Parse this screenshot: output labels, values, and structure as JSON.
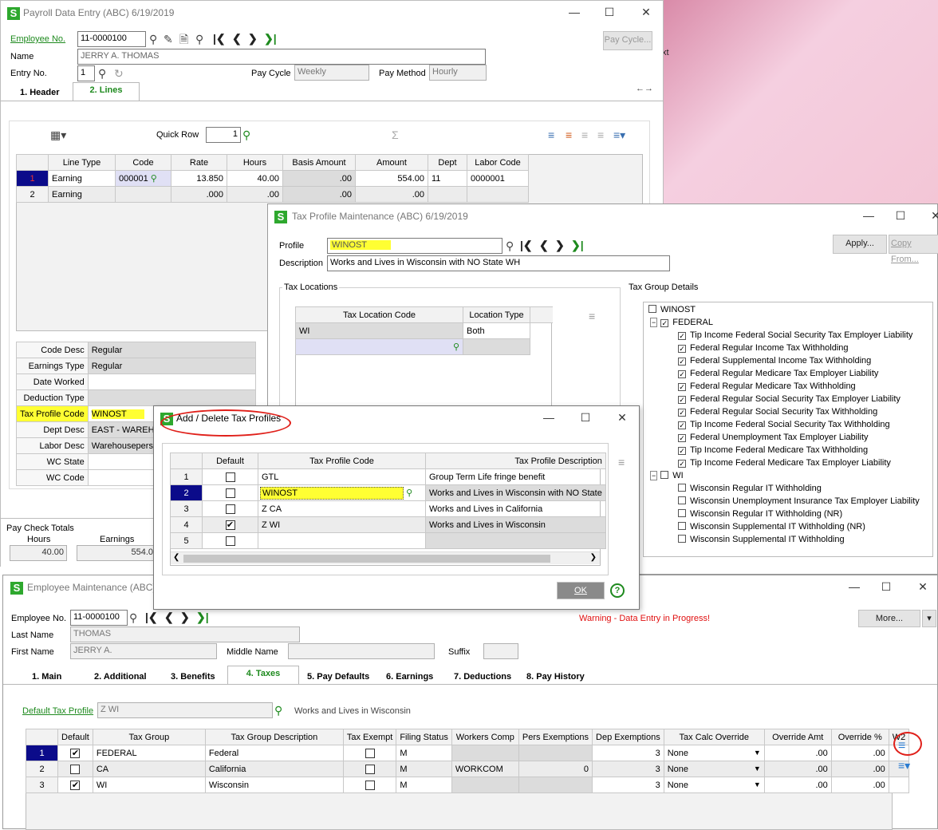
{
  "background": {
    "desktop_color": "#f3c6d6",
    "desktop_label": "xt"
  },
  "payroll": {
    "title": "Payroll Data Entry (ABC) 6/19/2019",
    "employee_no_label": "Employee No.",
    "employee_no": "11-0000100",
    "name_label": "Name",
    "name": "JERRY A. THOMAS",
    "entry_no_label": "Entry No.",
    "entry_no": "1",
    "pay_cycle_label": "Pay Cycle",
    "pay_cycle": "Weekly",
    "pay_method_label": "Pay Method",
    "pay_method": "Hourly",
    "pay_cycle_button": "Pay Cycle...",
    "tabs": [
      "1. Header",
      "2. Lines"
    ],
    "quick_row_label": "Quick Row",
    "quick_row": "1",
    "lines_headers": [
      "Line Type",
      "Code",
      "Rate",
      "Hours",
      "Basis Amount",
      "Amount",
      "Dept",
      "Labor Code"
    ],
    "lines_rows": [
      {
        "num": "1",
        "type": "Earning",
        "code": "000001",
        "rate": "13.850",
        "hours": "40.00",
        "basis": ".00",
        "amount": "554.00",
        "dept": "11",
        "labor": "0000001"
      },
      {
        "num": "2",
        "type": "Earning",
        "code": "",
        "rate": ".000",
        "hours": ".00",
        "basis": ".00",
        "amount": ".00",
        "dept": "",
        "labor": ""
      }
    ],
    "detail": [
      {
        "label": "Code Desc",
        "value": "Regular"
      },
      {
        "label": "Earnings Type",
        "value": "Regular"
      },
      {
        "label": "Date Worked",
        "value": ""
      },
      {
        "label": "Deduction Type",
        "value": ""
      },
      {
        "label": "Tax Profile Code",
        "value": "WINOST"
      },
      {
        "label": "Dept Desc",
        "value": "EAST - WAREHO"
      },
      {
        "label": "Labor Desc",
        "value": "Warehouseperso"
      },
      {
        "label": "WC State",
        "value": ""
      },
      {
        "label": "WC Code",
        "value": ""
      }
    ],
    "totals_label": "Pay Check Totals",
    "hours_label": "Hours",
    "hours_total": "40.00",
    "earnings_label": "Earnings",
    "earnings_total": "554.0"
  },
  "taxprofile": {
    "title": "Tax Profile Maintenance (ABC) 6/19/2019",
    "profile_label": "Profile",
    "profile": "WINOST",
    "description_label": "Description",
    "description": "Works and Lives in Wisconsin with NO State WH",
    "apply_button": "Apply...",
    "copy_button": "Copy From...",
    "locations_label": "Tax Locations",
    "loc_headers": [
      "Tax Location Code",
      "Location Type"
    ],
    "loc_rows": [
      {
        "code": "WI",
        "type": "Both"
      }
    ],
    "group_details_label": "Tax Group Details",
    "tree_root": "WINOST",
    "federal_label": "FEDERAL",
    "federal_items": [
      "Tip Income Federal Social Security Tax Employer Liability",
      "Federal Regular Income Tax Withholding",
      "Federal Supplemental Income Tax Withholding",
      "Federal Regular Medicare Tax Employer Liability",
      "Federal Regular Medicare Tax Withholding",
      "Federal Regular Social Security Tax Employer Liability",
      "Federal Regular Social Security Tax Withholding",
      "Tip Income Federal Social Security Tax Withholding",
      "Federal Unemployment Tax Employer Liability",
      "Tip Income Federal Medicare Tax Withholding",
      "Tip Income Federal Medicare Tax Employer Liability"
    ],
    "wi_label": "WI",
    "wi_items": [
      "Wisconsin Regular IT Withholding",
      "Wisconsin Unemployment Insurance Tax Employer Liability",
      "Wisconsin Regular IT Withholding (NR)",
      "Wisconsin Supplemental IT Withholding (NR)",
      "Wisconsin Supplemental IT Withholding"
    ]
  },
  "dialog": {
    "title": "Add / Delete Tax Profiles",
    "headers": [
      "Default",
      "Tax Profile Code",
      "Tax Profile Description"
    ],
    "rows": [
      {
        "num": "1",
        "checked": false,
        "code": "GTL",
        "desc": "Group Term Life fringe benefit"
      },
      {
        "num": "2",
        "checked": false,
        "code": "WINOST",
        "desc": "Works and Lives in Wisconsin with NO State"
      },
      {
        "num": "3",
        "checked": false,
        "code": "Z CA",
        "desc": "Works and Lives in California"
      },
      {
        "num": "4",
        "checked": true,
        "code": "Z WI",
        "desc": "Works and Lives in Wisconsin"
      },
      {
        "num": "5",
        "checked": false,
        "code": "",
        "desc": ""
      }
    ],
    "ok_button": "OK",
    "annotation_color": "#e0201a"
  },
  "employee": {
    "title": "Employee Maintenance (ABC)",
    "employee_no_label": "Employee No.",
    "employee_no": "11-0000100",
    "warning": "Warning - Data Entry in Progress!",
    "more_button": "More...",
    "last_name_label": "Last Name",
    "last_name": "THOMAS",
    "first_name_label": "First Name",
    "first_name": "JERRY A.",
    "middle_name_label": "Middle Name",
    "middle_name": "",
    "suffix_label": "Suffix",
    "suffix": "",
    "tabs": [
      "1. Main",
      "2. Additional",
      "3. Benefits",
      "4. Taxes",
      "5. Pay Defaults",
      "6. Earnings",
      "7. Deductions",
      "8. Pay History"
    ],
    "default_profile_label": "Default Tax Profile",
    "default_profile": "Z WI",
    "default_profile_desc": "Works and Lives in Wisconsin",
    "tax_headers": [
      "Default",
      "Tax Group",
      "Tax Group Description",
      "Tax Exempt",
      "Filing Status",
      "Workers Comp",
      "Pers Exemptions",
      "Dep Exemptions",
      "Tax Calc Override",
      "Override Amt",
      "Override %",
      "W2"
    ],
    "tax_rows": [
      {
        "num": "1",
        "default": true,
        "group": "FEDERAL",
        "desc": "Federal",
        "exempt": false,
        "filing": "M",
        "wc": "",
        "pers": "",
        "dep": "3",
        "calc": "None",
        "amt": ".00",
        "pct": ".00"
      },
      {
        "num": "2",
        "default": false,
        "group": "CA",
        "desc": "California",
        "exempt": false,
        "filing": "M",
        "wc": "WORKCOM",
        "pers": "0",
        "dep": "3",
        "calc": "None",
        "amt": ".00",
        "pct": ".00"
      },
      {
        "num": "3",
        "default": true,
        "group": "WI",
        "desc": "Wisconsin",
        "exempt": false,
        "filing": "M",
        "wc": "",
        "pers": "",
        "dep": "3",
        "calc": "None",
        "amt": ".00",
        "pct": ".00"
      }
    ]
  }
}
